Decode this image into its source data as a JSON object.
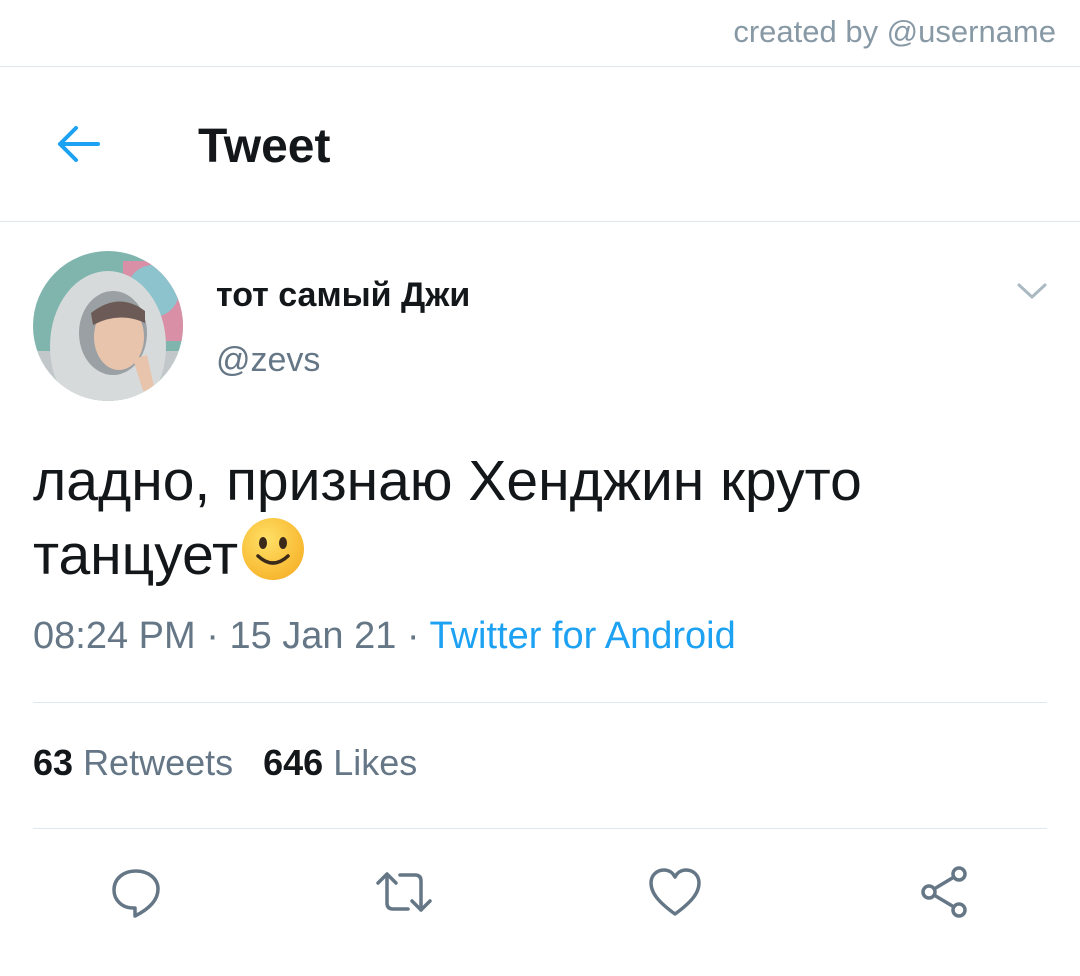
{
  "watermark": "created by @username",
  "header": {
    "title": "Tweet",
    "back_icon": "arrow-left-icon"
  },
  "tweet": {
    "author": {
      "display_name": "тот самый Джи",
      "handle": "@zevs"
    },
    "text": "ладно, признаю Хенджин круто танцует",
    "emoji": "slightly-smiling-face",
    "time": "08:24 PM",
    "date": "15 Jan 21",
    "source": "Twitter for Android",
    "separator": " · ",
    "retweets_count": "63",
    "retweets_label": "Retweets",
    "likes_count": "646",
    "likes_label": "Likes"
  },
  "actions": [
    "reply-icon",
    "retweet-icon",
    "like-icon",
    "share-icon"
  ],
  "colors": {
    "accent": "#1da1f2",
    "secondary_text": "#657786",
    "divider": "#e1e8ed"
  }
}
